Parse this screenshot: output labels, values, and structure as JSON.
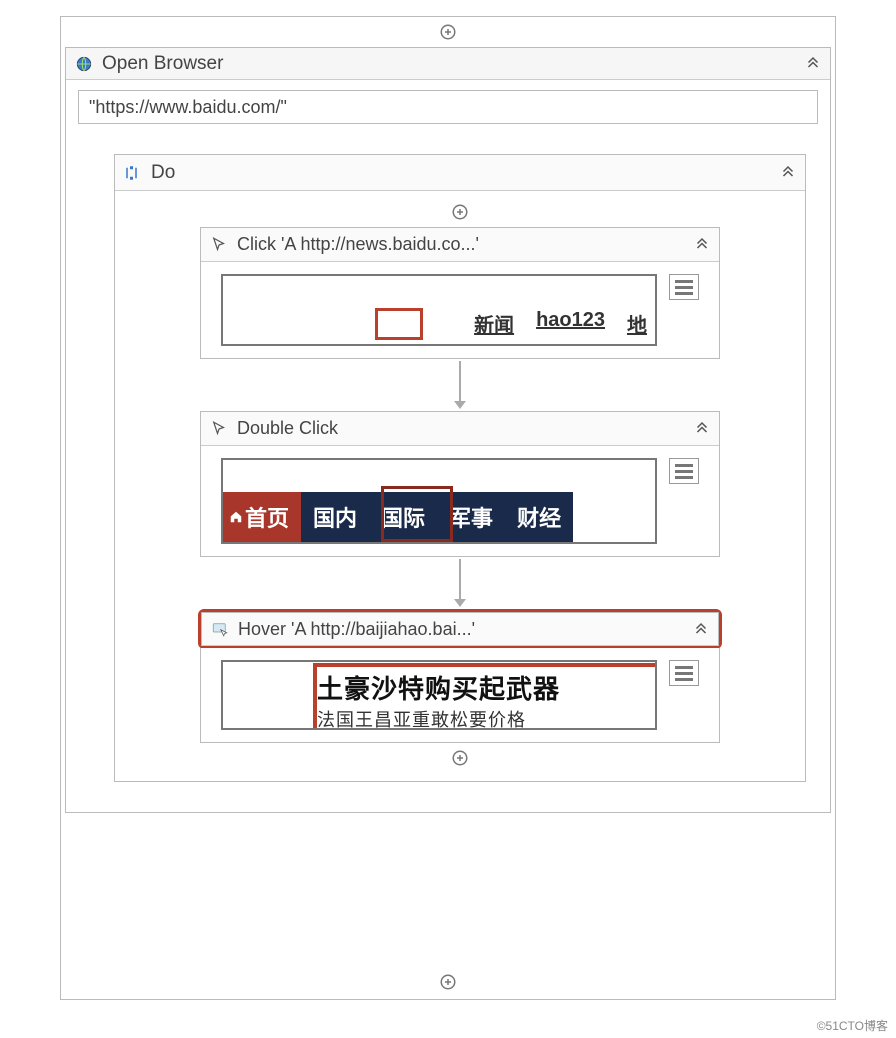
{
  "footer": {
    "watermark": "©51CTO博客"
  },
  "openBrowser": {
    "title": "Open Browser",
    "url": "\"https://www.baidu.com/\""
  },
  "do": {
    "title": "Do",
    "children": [
      {
        "type": "Click",
        "title": "Click 'A  http://news.baidu.co...'",
        "preview": {
          "links": [
            "新闻",
            "hao123",
            "地"
          ],
          "highlightedIndex": 0
        }
      },
      {
        "type": "DoubleClick",
        "title": "Double Click",
        "preview": {
          "tabs": [
            "首页",
            "国内",
            "国际",
            "军事",
            "财经"
          ],
          "homeIndex": 0,
          "highlightedIndex": 2
        }
      },
      {
        "type": "Hover",
        "title": "Hover 'A  http://baijiahao.bai...'",
        "preview": {
          "headline1": "土豪沙特购买起武器",
          "headline2": "法国王昌亚重敢松要价格"
        }
      }
    ]
  }
}
